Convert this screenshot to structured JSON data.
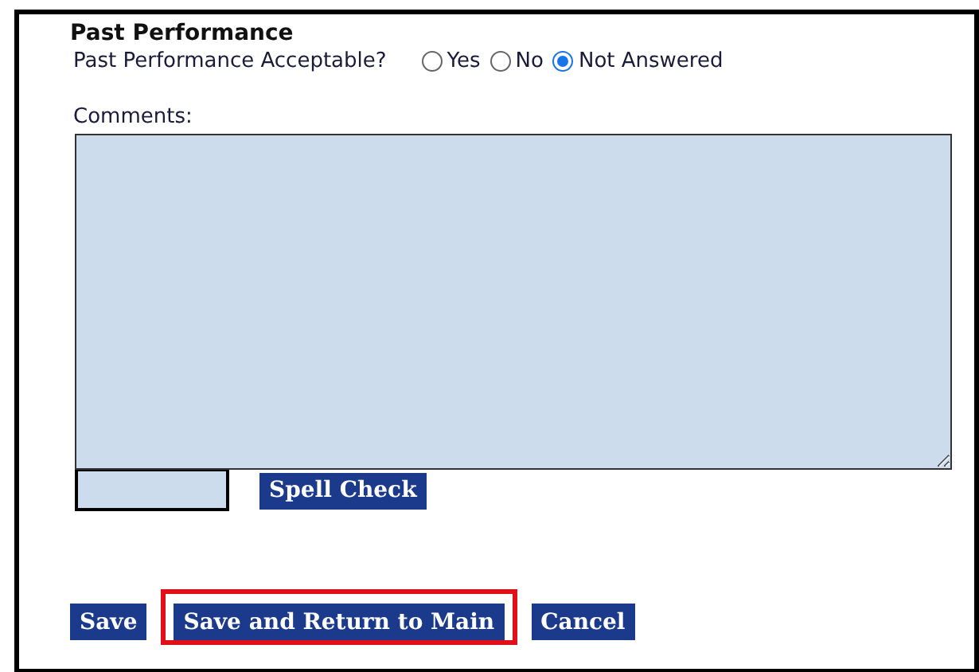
{
  "section": {
    "title": "Past Performance"
  },
  "question": {
    "label": "Past Performance Acceptable?",
    "options": [
      {
        "label": "Yes",
        "selected": false
      },
      {
        "label": "No",
        "selected": false
      },
      {
        "label": "Not Answered",
        "selected": true
      }
    ]
  },
  "comments": {
    "label": "Comments:"
  },
  "spell_check": {
    "label": "Spell Check"
  },
  "buttons": [
    {
      "label": "Save",
      "highlighted": false
    },
    {
      "label": "Save and Return to Main",
      "highlighted": true
    },
    {
      "label": "Cancel",
      "highlighted": false
    }
  ]
}
